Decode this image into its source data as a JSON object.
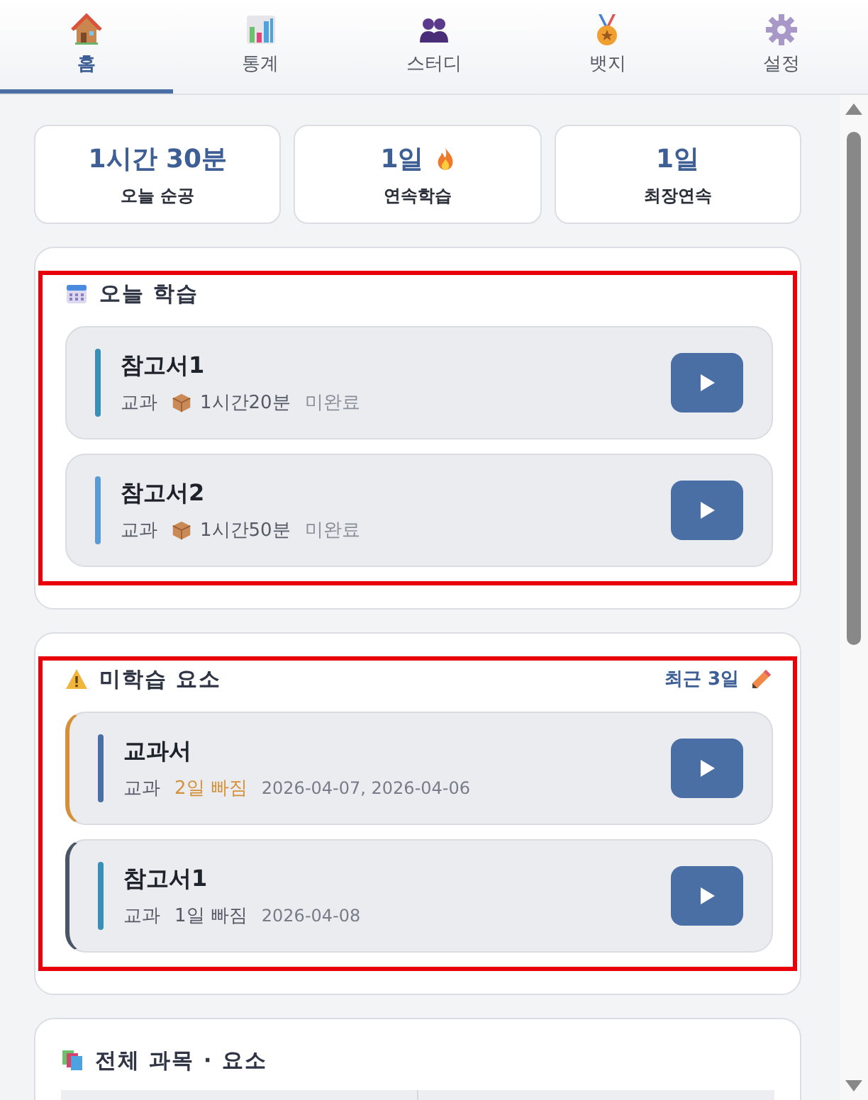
{
  "tabs": [
    {
      "label": "홈",
      "selected": true
    },
    {
      "label": "통계",
      "selected": false
    },
    {
      "label": "스터디",
      "selected": false
    },
    {
      "label": "뱃지",
      "selected": false
    },
    {
      "label": "설정",
      "selected": false
    }
  ],
  "stats": [
    {
      "value": "1시간 30분",
      "label": "오늘 순공",
      "fire": false
    },
    {
      "value": "1일",
      "label": "연속학습",
      "fire": true
    },
    {
      "value": "1일",
      "label": "최장연속",
      "fire": false
    }
  ],
  "today": {
    "title": "오늘 학습",
    "highlighted": true,
    "items": [
      {
        "name": "참고서1",
        "category": "교과",
        "duration": "1시간20분",
        "status": "미완료",
        "color": "#3a8fb7"
      },
      {
        "name": "참고서2",
        "category": "교과",
        "duration": "1시간50분",
        "status": "미완료",
        "color": "#5b9bd5"
      }
    ]
  },
  "missed": {
    "title": "미학습 요소",
    "filter": "최근 3일",
    "highlighted": true,
    "items": [
      {
        "name": "교과서",
        "category": "교과",
        "missed": "2일 빠짐",
        "dates": "2026-04-07, 2026-04-06",
        "kind": "warning",
        "color": "#4a6fa5"
      },
      {
        "name": "참고서1",
        "category": "교과",
        "missed": "1일 빠짐",
        "dates": "2026-04-08",
        "kind": "normal",
        "color": "#3a8fb7"
      }
    ]
  },
  "all": {
    "title": "전체 과목 · 요소"
  }
}
